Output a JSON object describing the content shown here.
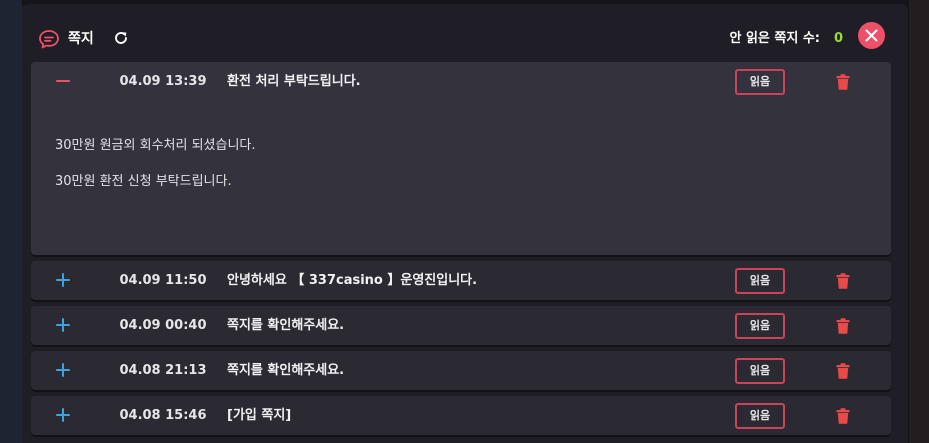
{
  "header": {
    "title": "쪽지",
    "unread_label": "안 읽은 쪽지 수:",
    "unread_count": "0"
  },
  "colors": {
    "accent": "#ef5069",
    "count": "#9bdc2a",
    "plus": "#3fa3e0"
  },
  "messages": [
    {
      "expanded": true,
      "toggle_icon": "minus-icon",
      "date": "04.09 13:39",
      "subject": "환전 처리 부탁드립니다.",
      "read_label": "읽음",
      "body_lines": [
        "30만원 원금외 회수처리 되셨습니다.",
        "30만원 환전 신청 부탁드립니다."
      ]
    },
    {
      "expanded": false,
      "toggle_icon": "plus-icon",
      "date": "04.09 11:50",
      "subject": "안녕하세요 【 337casino 】운영진입니다.",
      "read_label": "읽음"
    },
    {
      "expanded": false,
      "toggle_icon": "plus-icon",
      "date": "04.09 00:40",
      "subject": "쪽지를 확인해주세요.",
      "read_label": "읽음"
    },
    {
      "expanded": false,
      "toggle_icon": "plus-icon",
      "date": "04.08 21:13",
      "subject": "쪽지를 확인해주세요.",
      "read_label": "읽음"
    },
    {
      "expanded": false,
      "toggle_icon": "plus-icon",
      "date": "04.08 15:46",
      "subject": "[가입 쪽지]",
      "read_label": "읽음"
    }
  ]
}
